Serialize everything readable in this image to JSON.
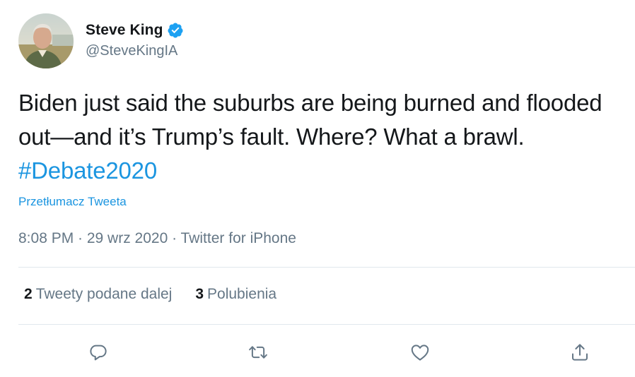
{
  "author": {
    "display_name": "Steve King",
    "handle": "@SteveKingIA",
    "verified": true,
    "avatar_icon": "user-avatar-photo"
  },
  "tweet": {
    "text_main": "Biden just said the suburbs are being burned and flooded out—and it’s Trump’s fault. Where? What a brawl. ",
    "hashtag": "#Debate2020",
    "translate_label": "Przetłumacz Tweeta",
    "meta": "8:08 PM · 29 wrz 2020 · Twitter for iPhone"
  },
  "stats": {
    "retweets_count": "2",
    "retweets_label": "Tweety podane dalej",
    "likes_count": "3",
    "likes_label": "Polubienia"
  },
  "actions": {
    "reply_icon": "reply-icon",
    "retweet_icon": "retweet-icon",
    "like_icon": "heart-icon",
    "share_icon": "share-icon"
  },
  "colors": {
    "text": "#14171a",
    "secondary": "#657786",
    "link": "#1b95e0",
    "divider": "#e1e8ed",
    "verified": "#1da1f2"
  }
}
